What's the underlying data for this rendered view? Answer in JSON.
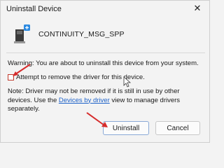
{
  "window": {
    "title": "Uninstall Device",
    "close_glyph": "✕"
  },
  "device": {
    "name": "CONTINUITY_MSG_SPP",
    "icon": "bluetooth-device-icon"
  },
  "warning_text": "Warning: You are about to uninstall this device from your system.",
  "checkbox": {
    "label": "Attempt to remove the driver for this device.",
    "checked": false
  },
  "note": {
    "prefix": "Note: Driver may not be removed if it is still in use by other devices. Use the ",
    "link": "Devices by driver",
    "suffix": " view to manage drivers separately."
  },
  "buttons": {
    "uninstall": "Uninstall",
    "cancel": "Cancel"
  },
  "annotation_color": "#d62c2c"
}
